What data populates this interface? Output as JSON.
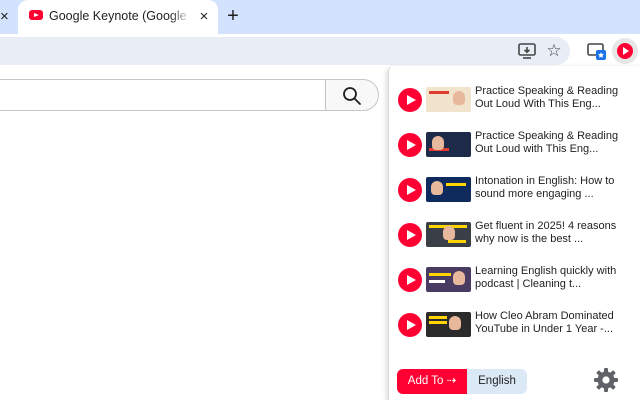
{
  "browser": {
    "tab": {
      "title": "Google Keynote (Google I/O '"
    },
    "icons": {
      "close": "×",
      "new_tab": "+",
      "star": "☆"
    }
  },
  "colors": {
    "accent": "#ff0033",
    "tabstrip": "#d3e3fd",
    "language_button": "#dbe8f6"
  },
  "popup": {
    "videos": [
      {
        "title": "Practice Speaking & Reading Out Loud With This Eng...",
        "thumb_bg": "#f2e4cc"
      },
      {
        "title": "Practice Speaking & Reading Out Loud with This Eng...",
        "thumb_bg": "#1e2a4a"
      },
      {
        "title": "Intonation in English: How to sound more engaging ...",
        "thumb_bg": "#0f2a5c"
      },
      {
        "title": "Get fluent in 2025! 4 reasons why now is the best ...",
        "thumb_bg": "#3a3f47"
      },
      {
        "title": "Learning English quickly with podcast | Cleaning t...",
        "thumb_bg": "#4a3b63"
      },
      {
        "title": "How Cleo Abram Dominated YouTube in Under 1 Year -...",
        "thumb_bg": "#2b2b2b"
      }
    ],
    "add_to_label": "Add To ⇢",
    "language_label": "English"
  }
}
